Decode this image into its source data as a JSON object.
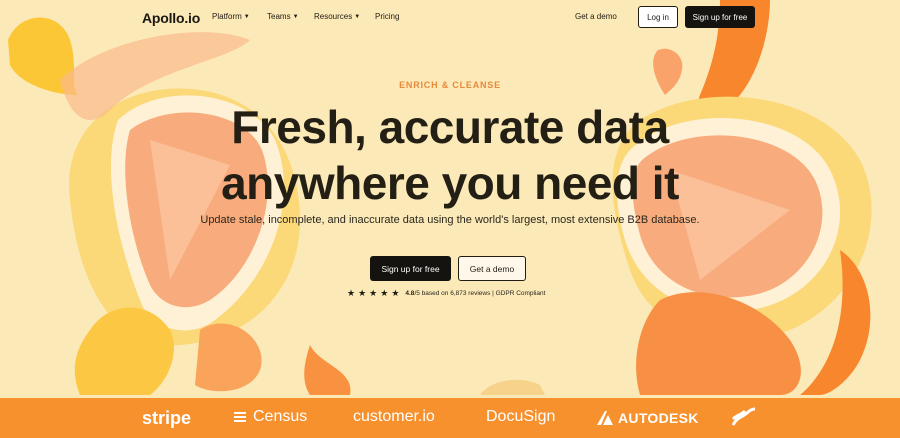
{
  "nav": {
    "logo": "Apollo.io",
    "links": [
      {
        "label": "Platform",
        "has_dropdown": true
      },
      {
        "label": "Teams",
        "has_dropdown": true
      },
      {
        "label": "Resources",
        "has_dropdown": true
      },
      {
        "label": "Pricing",
        "has_dropdown": false
      }
    ],
    "get_demo": "Get a demo",
    "login": "Log in",
    "signup": "Sign up for free"
  },
  "hero": {
    "eyebrow": "ENRICH & CLEANSE",
    "headline_line1": "Fresh, accurate data",
    "headline_line2": "anywhere you need it",
    "subtitle": "Update stale, incomplete, and inaccurate data using the world's largest, most extensive B2B database.",
    "primary_cta": "Sign up for free",
    "secondary_cta": "Get a demo",
    "rating_score": "4.8",
    "rating_text": "/5 based on 6,873 reviews | GDPR Compliant",
    "stars": 5
  },
  "logos": [
    "stripe",
    "Census",
    "customer.io",
    "DocuSign",
    "AUTODESK"
  ],
  "colors": {
    "background": "#fce9b8",
    "accent_orange": "#f7912e",
    "eyebrow": "#e68a3c",
    "dark": "#15130f"
  },
  "icons": {
    "chevron": "chevron-down-icon",
    "star": "star-icon"
  }
}
